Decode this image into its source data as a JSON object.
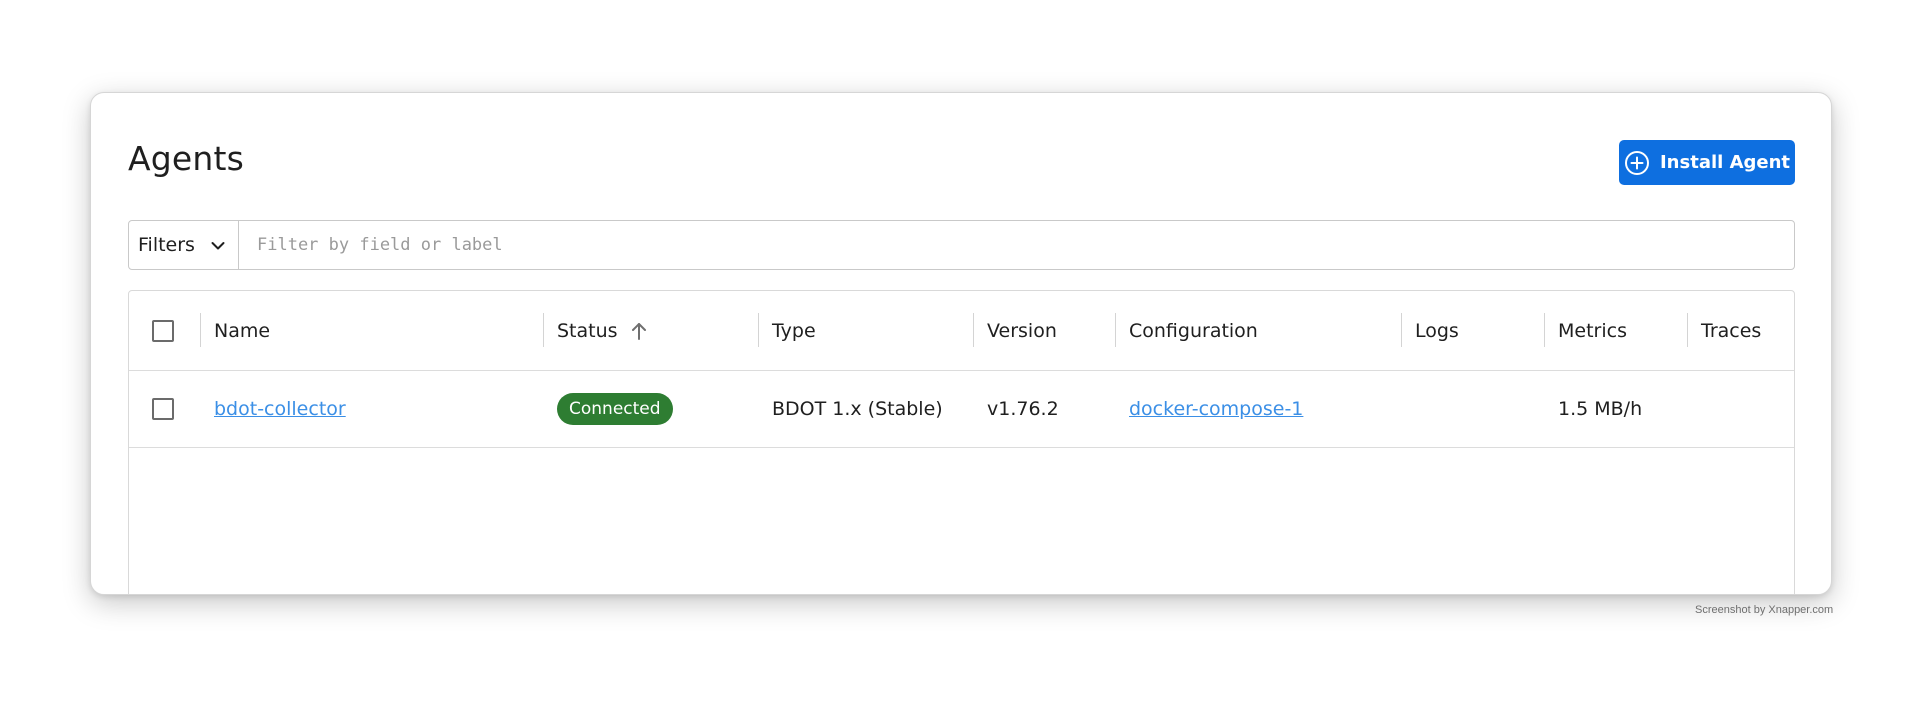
{
  "page": {
    "title": "Agents",
    "install_button_label": "Install Agent",
    "accent_color": "#0e6fe0",
    "link_color": "#3b8fe6",
    "status_connected_color": "#2e7d32"
  },
  "filter": {
    "toggle_label": "Filters",
    "placeholder": "Filter by field or label",
    "value": ""
  },
  "table": {
    "columns": [
      "Name",
      "Status",
      "Type",
      "Version",
      "Configuration",
      "Logs",
      "Metrics",
      "Traces"
    ],
    "sorted_column": "Status",
    "sort_direction": "ascending",
    "rows": [
      {
        "name": "bdot-collector",
        "status": "Connected",
        "type": "BDOT 1.x (Stable)",
        "version": "v1.76.2",
        "configuration": "docker-compose-1",
        "logs": "",
        "metrics": "1.5 MB/h",
        "traces": ""
      }
    ]
  },
  "icons": {
    "install": "plus-circle-icon",
    "filters": "chevron-down-icon",
    "sort": "arrow-up-icon"
  },
  "watermark": "Screenshot by Xnapper.com"
}
